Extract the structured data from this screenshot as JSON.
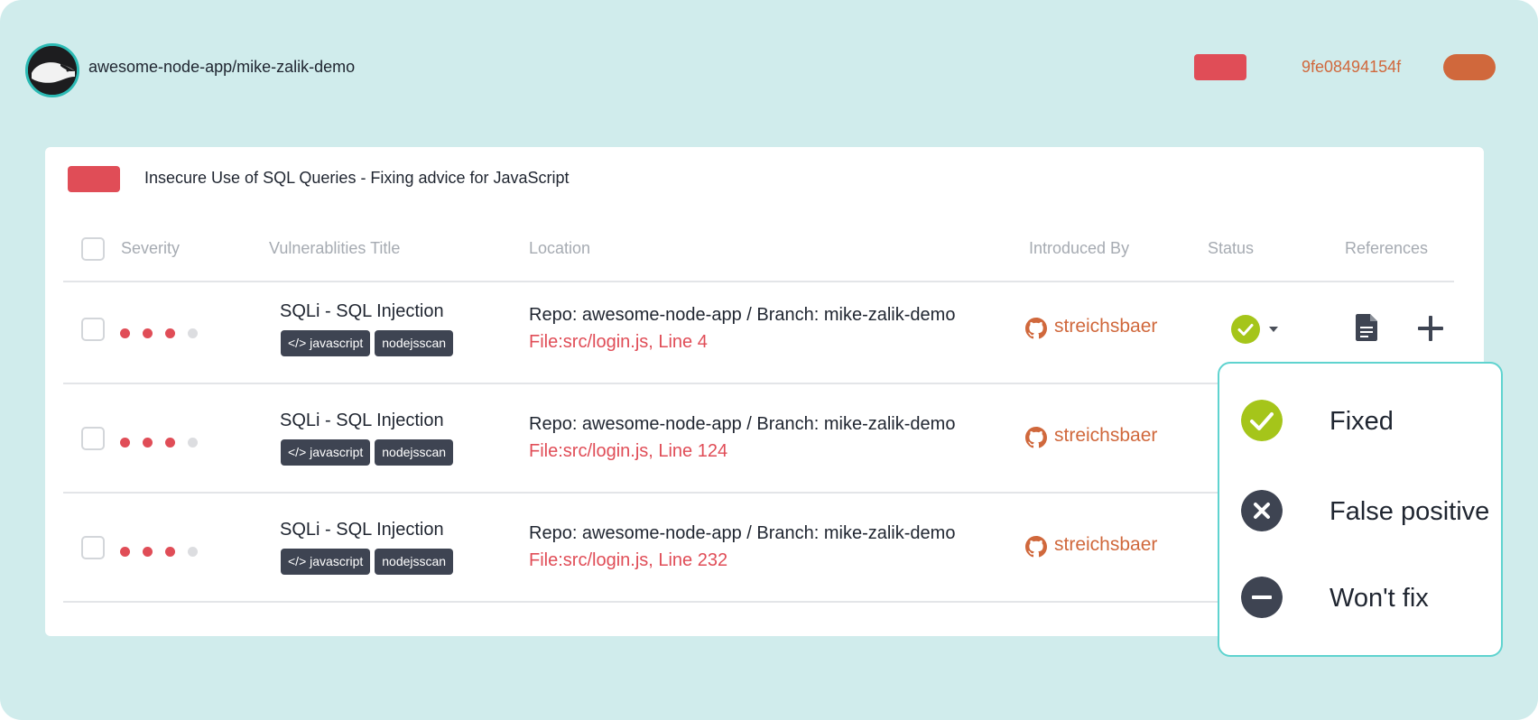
{
  "header": {
    "repo": "awesome-node-app/mike-zalik-demo",
    "commit": "9fe08494154f",
    "colors": {
      "red_badge": "#e04d57",
      "orange_pill": "#d0683c"
    }
  },
  "card": {
    "title": "Insecure Use of SQL Queries - Fixing advice for JavaScript",
    "columns": {
      "severity": "Severity",
      "title": "Vulnerablities Title",
      "location": "Location",
      "introduced_by": "Introduced By",
      "status": "Status",
      "references": "References"
    },
    "rows": [
      {
        "severity_level": 3,
        "severity_max": 4,
        "title": "SQLi - SQL Injection",
        "tags": [
          "</> javascript",
          "nodejsscan"
        ],
        "repo_line": "Repo: awesome-node-app / Branch: mike-zalik-demo",
        "file_line": "File:src/login.js, Line 4",
        "author": "streichsbaer",
        "status": "fixed"
      },
      {
        "severity_level": 3,
        "severity_max": 4,
        "title": "SQLi - SQL Injection",
        "tags": [
          "</> javascript",
          "nodejsscan"
        ],
        "repo_line": "Repo: awesome-node-app / Branch: mike-zalik-demo",
        "file_line": "File:src/login.js, Line 124",
        "author": "streichsbaer"
      },
      {
        "severity_level": 3,
        "severity_max": 4,
        "title": "SQLi - SQL Injection",
        "tags": [
          "</> javascript",
          "nodejsscan"
        ],
        "repo_line": "Repo: awesome-node-app / Branch: mike-zalik-demo",
        "file_line": "File:src/login.js, Line 232",
        "author": "streichsbaer"
      }
    ]
  },
  "status_menu": {
    "options": [
      {
        "label": "Fixed",
        "icon": "check-circle-icon",
        "color": "#a5c51a"
      },
      {
        "label": "False positive",
        "icon": "x-circle-icon",
        "color": "#3e4452"
      },
      {
        "label": "Won't fix",
        "icon": "minus-circle-icon",
        "color": "#3e4452"
      }
    ]
  }
}
